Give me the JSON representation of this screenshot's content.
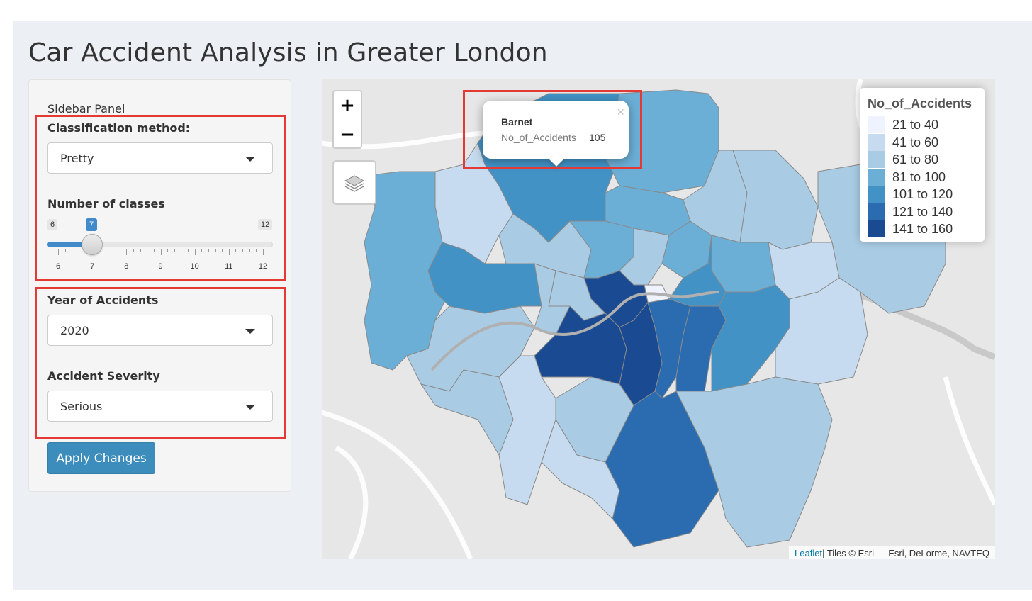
{
  "page": {
    "title": "Car Accident Analysis in Greater London"
  },
  "sidebar": {
    "label": "Sidebar Panel",
    "classification": {
      "label": "Classification method:",
      "value": "Pretty"
    },
    "num_classes": {
      "label": "Number of classes",
      "min_label": "6",
      "max_label": "12",
      "value_label": "7",
      "value": 7,
      "min": 6,
      "max": 12,
      "ticks": [
        "6",
        "7",
        "8",
        "9",
        "10",
        "11",
        "12"
      ]
    },
    "year": {
      "label": "Year of Accidents",
      "value": "2020"
    },
    "severity": {
      "label": "Accident Severity",
      "value": "Serious"
    },
    "apply_label": "Apply Changes"
  },
  "map": {
    "zoom_in": "+",
    "zoom_out": "−",
    "popup": {
      "name": "Barnet",
      "key": "No_of_Accidents",
      "value": "105",
      "close": "×"
    },
    "legend": {
      "title": "No_of_Accidents",
      "items": [
        {
          "label": "21 to 40",
          "color": "#eff3ff"
        },
        {
          "label": "41 to 60",
          "color": "#c6dbef"
        },
        {
          "label": "61 to 80",
          "color": "#a9cce4"
        },
        {
          "label": "81 to 100",
          "color": "#6baed6"
        },
        {
          "label": "101 to 120",
          "color": "#4292c6"
        },
        {
          "label": "121 to 140",
          "color": "#2b6cb0"
        },
        {
          "label": "141 to 160",
          "color": "#1a4a91"
        }
      ]
    },
    "attribution": {
      "link": "Leaflet",
      "rest": " | Tiles © Esri — Esri, DeLorme, NAVTEQ"
    }
  },
  "colors": {
    "accent": "#3c8dbc",
    "highlight": "#e53935"
  }
}
